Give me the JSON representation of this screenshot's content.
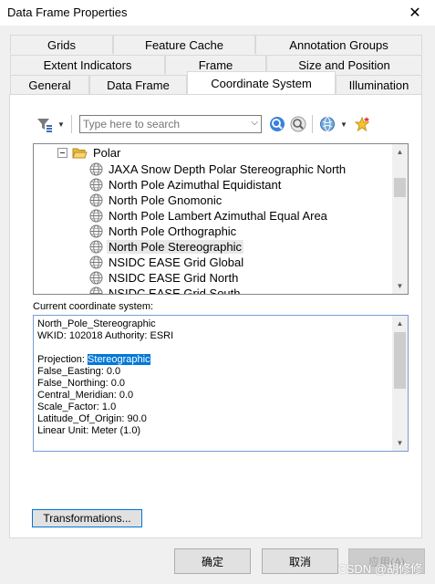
{
  "window": {
    "title": "Data Frame Properties",
    "close_glyph": "✕"
  },
  "tabs": {
    "row1": [
      "Grids",
      "Feature Cache",
      "Annotation Groups"
    ],
    "row2": [
      "Extent Indicators",
      "Frame",
      "Size and Position"
    ],
    "row3": [
      "General",
      "Data Frame",
      "Coordinate System",
      "Illumination"
    ],
    "active": "Coordinate System"
  },
  "toolbar": {
    "search_placeholder": "Type here to search",
    "icons": [
      "filter-icon",
      "search-go-icon",
      "clear-search-icon",
      "globe-add-icon",
      "new-favorite-icon"
    ]
  },
  "tree": {
    "folder": "Polar",
    "items": [
      "JAXA Snow Depth Polar Stereographic North",
      "North Pole Azimuthal Equidistant",
      "North Pole Gnomonic",
      "North Pole Lambert Azimuthal Equal Area",
      "North Pole Orthographic",
      "North Pole Stereographic",
      "NSIDC EASE Grid Global",
      "NSIDC EASE Grid North",
      "NSIDC EASE Grid South"
    ],
    "selected_index": 5
  },
  "current": {
    "label": "Current coordinate system:",
    "name": "North_Pole_Stereographic",
    "wkid": "WKID: 102018 Authority: ESRI",
    "projection_label": "Projection:",
    "projection_value": "Stereographic",
    "params": [
      "False_Easting: 0.0",
      "False_Northing: 0.0",
      "Central_Meridian: 0.0",
      "Scale_Factor: 1.0",
      "Latitude_Of_Origin: 90.0",
      "Linear Unit: Meter (1.0)"
    ]
  },
  "buttons": {
    "transformations": "Transformations...",
    "ok": "确定",
    "cancel": "取消",
    "apply": "应用(A)"
  },
  "watermark": "CSDN @胡修修",
  "colors": {
    "selection": "#0078d7",
    "default_button_border": "#0078d7"
  }
}
